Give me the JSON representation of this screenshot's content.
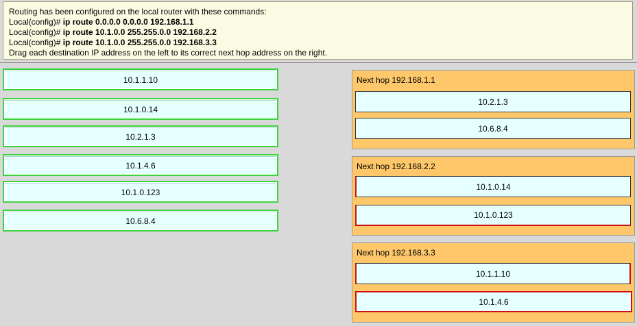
{
  "instructions": {
    "line1": "Routing has been configured on the local router with these commands:",
    "cmd1_prompt": "Local(config)# ",
    "cmd1": "ip route 0.0.0.0 0.0.0.0 192.168.1.1",
    "cmd2_prompt": "Local(config)# ",
    "cmd2": "ip route 10.1.0.0 255.255.0.0 192.168.2.2",
    "cmd3_prompt": "Local(config)# ",
    "cmd3": "ip route 10.1.0.0 255.255.0.0 192.168.3.3",
    "line5": "Drag each destination IP address on the left to its correct next hop address on the right."
  },
  "sources": [
    "10.1.1.10",
    "10.1.0.14",
    "10.2.1.3",
    "10.1.4.6",
    "10.1.0.123",
    "10.6.8.4"
  ],
  "targets": [
    {
      "title": "Next hop 192.168.1.1",
      "items": [
        "10.2.1.3",
        "10.6.8.4"
      ]
    },
    {
      "title": "Next hop 192.168.2.2",
      "items": [
        "10.1.0.14",
        "10.1.0.123"
      ]
    },
    {
      "title": "Next hop 192.168.3.3",
      "items": [
        "10.1.1.10",
        "10.1.4.6"
      ]
    }
  ],
  "colors": {
    "source_border": "#3ad43a",
    "item_fill": "#e6ffff",
    "target_fill": "#fec86a",
    "incorrect_border": "#d01010"
  }
}
